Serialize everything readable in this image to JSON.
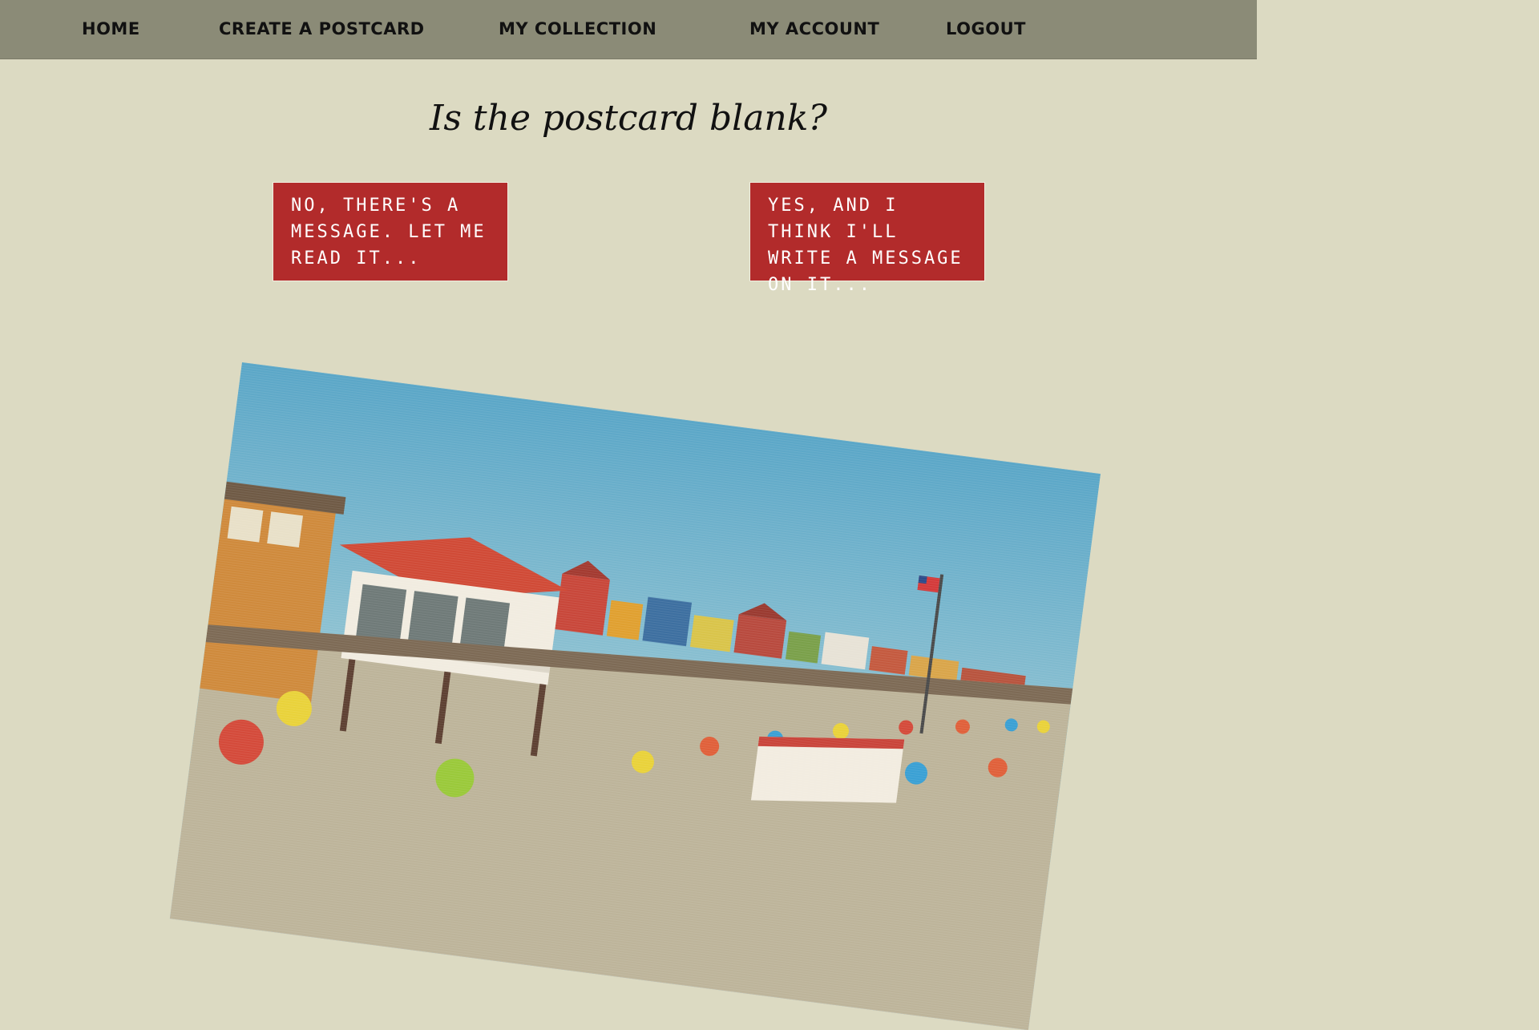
{
  "nav": {
    "home": "Home",
    "create": "Create a Postcard",
    "collection": "My Collection",
    "account": "My Account",
    "logout": "Logout"
  },
  "question": "Is the postcard blank?",
  "choices": {
    "no": "No, there's a message. Let me read it...",
    "yes": "Yes, and I think I'll write a message on it..."
  },
  "colors": {
    "nav_bg": "#8b8b77",
    "page_bg": "#dcdac2",
    "button_bg": "#b22b2b"
  },
  "postcard": {
    "image_name": "vintage-boardwalk-beach-postcard-icon"
  }
}
